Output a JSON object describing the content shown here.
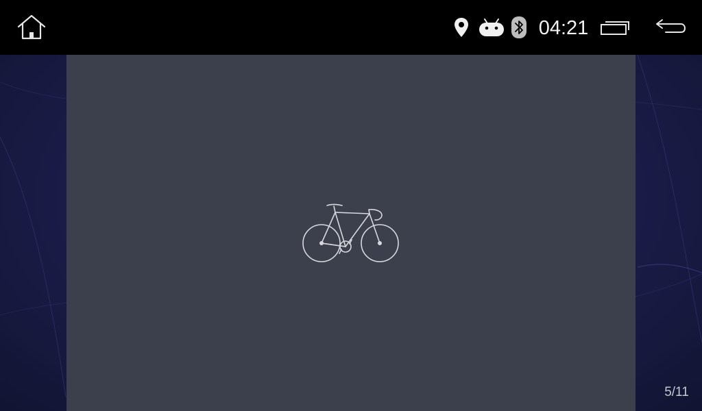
{
  "status_bar": {
    "home_icon": "home-icon",
    "location_icon": "location-pin-icon",
    "android_icon": "android-icon",
    "bluetooth_icon": "bluetooth-icon",
    "time": "04:21",
    "recents_icon": "recent-apps-icon",
    "back_icon": "back-arrow-icon"
  },
  "content": {
    "image_icon": "bicycle-icon",
    "page_indicator": "5/11"
  },
  "colors": {
    "status_bar_bg": "#000000",
    "panel_bg": "#3b404c",
    "wallpaper": "#1c1e4e",
    "icon_color": "#e6e6e6"
  }
}
